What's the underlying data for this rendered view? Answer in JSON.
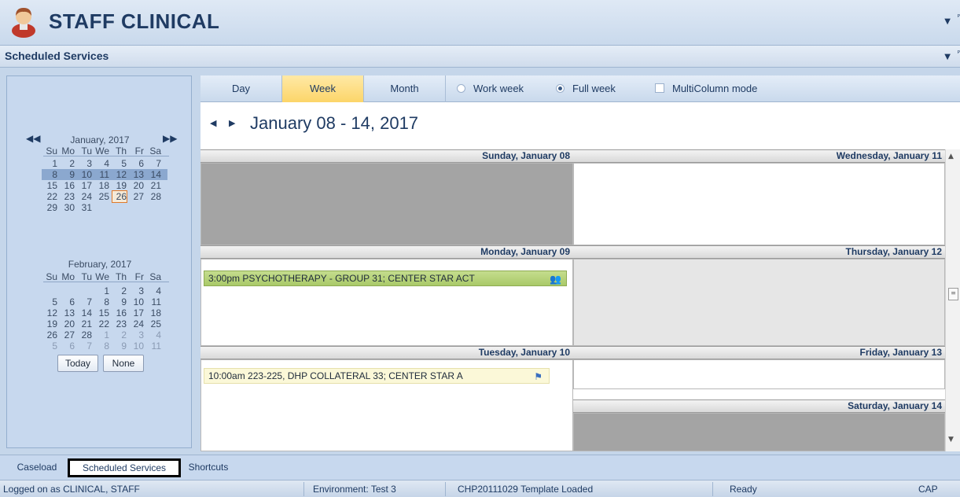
{
  "app": {
    "title": "STAFF CLINICAL",
    "icon": "user-avatar-icon"
  },
  "section": {
    "title": "Scheduled Services"
  },
  "navigator": {
    "months": [
      {
        "title": "January, 2017",
        "dow": [
          "Su",
          "Mo",
          "Tu",
          "We",
          "Th",
          "Fr",
          "Sa"
        ],
        "weeks": [
          [
            "1",
            "2",
            "3",
            "4",
            "5",
            "6",
            "7"
          ],
          [
            "8",
            "9",
            "10",
            "11",
            "12",
            "13",
            "14"
          ],
          [
            "15",
            "16",
            "17",
            "18",
            "19",
            "20",
            "21"
          ],
          [
            "22",
            "23",
            "24",
            "25",
            "26",
            "27",
            "28"
          ],
          [
            "29",
            "30",
            "31",
            "",
            "",
            "",
            ""
          ]
        ],
        "selected_week": 1,
        "today": "26"
      },
      {
        "title": "February, 2017",
        "dow": [
          "Su",
          "Mo",
          "Tu",
          "We",
          "Th",
          "Fr",
          "Sa"
        ],
        "weeks": [
          [
            "",
            "",
            "",
            "1",
            "2",
            "3",
            "4"
          ],
          [
            "5",
            "6",
            "7",
            "8",
            "9",
            "10",
            "11"
          ],
          [
            "12",
            "13",
            "14",
            "15",
            "16",
            "17",
            "18"
          ],
          [
            "19",
            "20",
            "21",
            "22",
            "23",
            "24",
            "25"
          ],
          [
            "26",
            "27",
            "28",
            "1",
            "2",
            "3",
            "4"
          ],
          [
            "5",
            "6",
            "7",
            "8",
            "9",
            "10",
            "11"
          ]
        ]
      }
    ],
    "today_button": "Today",
    "none_button": "None"
  },
  "toolbar": {
    "views": [
      "Day",
      "Week",
      "Month"
    ],
    "active_view": "Week",
    "work_week": "Work week",
    "full_week": "Full week",
    "multicolumn": "MultiColumn mode",
    "selected_week_mode": "Full week"
  },
  "range_title": "January 08 - 14, 2017",
  "days": {
    "sun": "Sunday, January 08",
    "mon": "Monday, January 09",
    "tue": "Tuesday, January 10",
    "wed": "Wednesday, January 11",
    "thu": "Thursday, January 12",
    "fri": "Friday, January 13",
    "sat": "Saturday, January 14"
  },
  "appointments": [
    {
      "time": "3:00pm",
      "text": "PSYCHOTHERAPY - GROUP 31; CENTER STAR ACT",
      "icon": "group-icon"
    },
    {
      "time": "10:00am",
      "text": "223-225, DHP COLLATERAL 33; CENTER STAR A",
      "icon": "flag-icon"
    }
  ],
  "bottom_tabs": [
    "Caseload",
    "Scheduled Services",
    "Shortcuts"
  ],
  "status": {
    "user": "Logged on as CLINICAL, STAFF",
    "environment": "Environment: Test 3",
    "template": "CHP20111029 Template Loaded",
    "state": "Ready",
    "caps": "CAP"
  },
  "colors": {
    "accent": "#fcd569",
    "header": "#1f3b63",
    "appt_green": "#b5d27a",
    "appt_yellow": "#fbf8d8"
  }
}
